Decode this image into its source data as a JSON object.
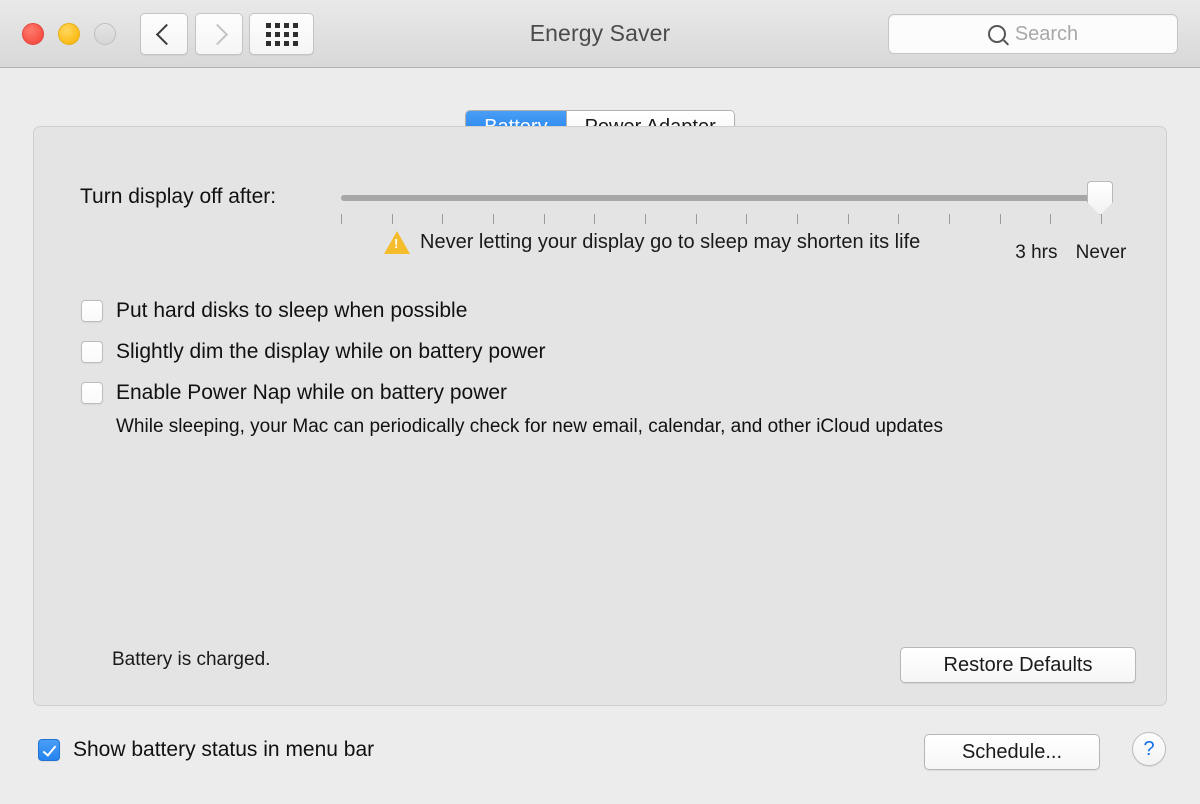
{
  "window": {
    "title": "Energy Saver",
    "traffic_lights": {
      "close_color": "#f9564a",
      "minimize_color": "#fcc021",
      "zoom_color": "#dcdcdc"
    }
  },
  "toolbar": {
    "back_icon": "chevron-left-icon",
    "forward_icon": "chevron-right-icon",
    "grid_icon": "show-all-grid-icon",
    "search": {
      "placeholder": "Search",
      "value": "",
      "icon": "search-icon"
    }
  },
  "tabs": {
    "selected": "Battery",
    "items": [
      {
        "label": "Battery",
        "selected": true
      },
      {
        "label": "Power Adapter",
        "selected": false
      }
    ],
    "active_color": "#187bea"
  },
  "slider": {
    "label": "Turn display off after:",
    "value": "Never",
    "tick_count": 16,
    "tick_labels": [
      {
        "text": "3 hrs",
        "pos_pct": 91.5
      },
      {
        "text": "Never",
        "pos_pct": 100
      }
    ],
    "warning": {
      "icon": "warning-triangle-icon",
      "text": "Never letting your display go to sleep may shorten its life",
      "color": "#f5bc2c"
    }
  },
  "options": [
    {
      "label": "Put hard disks to sleep when possible",
      "checked": false
    },
    {
      "label": "Slightly dim the display while on battery power",
      "checked": false
    },
    {
      "label": "Enable Power Nap while on battery power",
      "checked": false
    }
  ],
  "power_nap_description": "While sleeping, your Mac can periodically check for new email, calendar, and other iCloud updates",
  "status": {
    "battery_text": "Battery is charged."
  },
  "buttons": {
    "restore_defaults": "Restore Defaults",
    "schedule": "Schedule...",
    "help": "?"
  },
  "footer": {
    "menu_bar_option": {
      "label": "Show battery status in menu bar",
      "checked": true,
      "checked_color": "#2483ef"
    }
  }
}
